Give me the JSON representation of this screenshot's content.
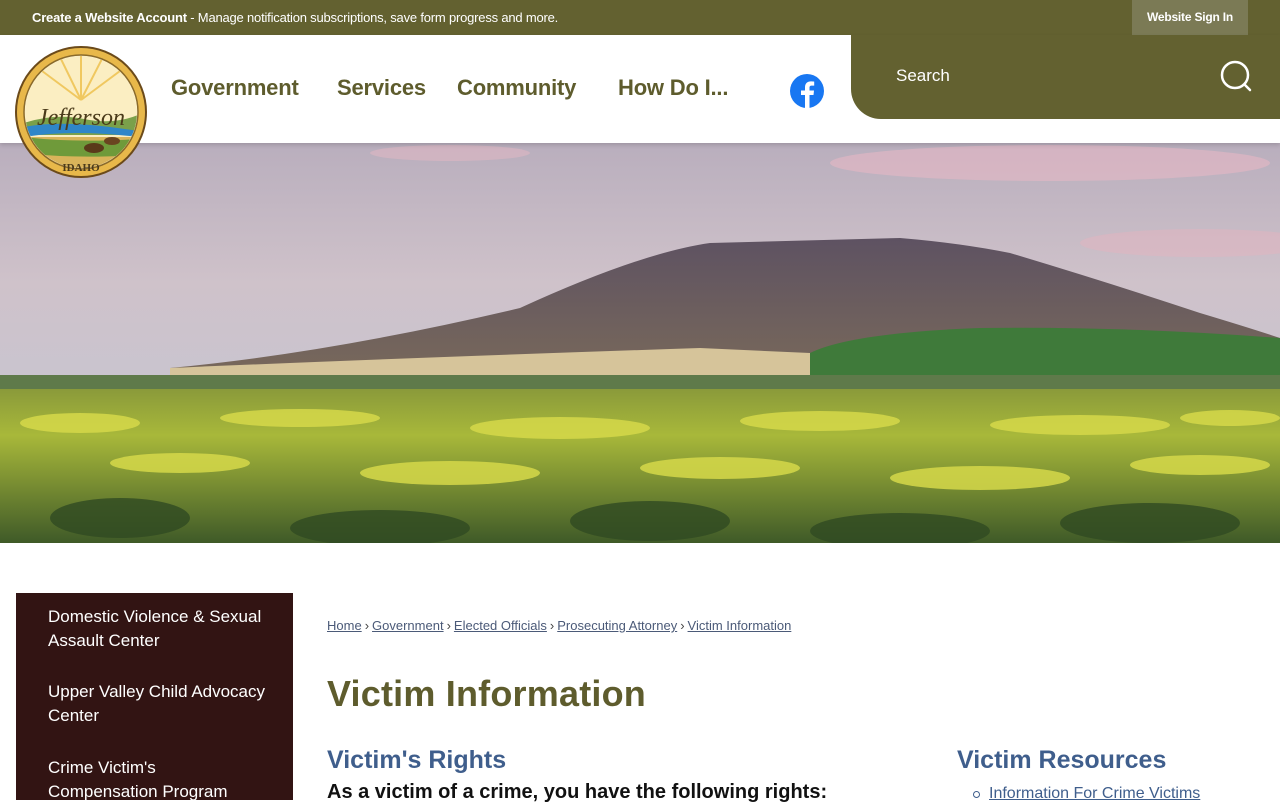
{
  "topbar": {
    "account_link": "Create a Website Account",
    "account_desc": " - Manage notification subscriptions, save form progress and more.",
    "signin_label": "Website Sign In"
  },
  "header": {
    "logo_icon": "jefferson-county-seal-icon",
    "nav": [
      {
        "label": "Government"
      },
      {
        "label": "Services"
      },
      {
        "label": "Community"
      },
      {
        "label": "How Do I..."
      }
    ],
    "social_icon": "facebook-icon",
    "search": {
      "placeholder": "Search",
      "icon": "search-icon"
    }
  },
  "colors": {
    "brand_olive": "#636130",
    "sidebar_bg": "#321413",
    "heading_blue": "#3f5e8c",
    "title_olive": "#5e5c2d",
    "facebook_blue": "#1877f2"
  },
  "sidebar": {
    "items": [
      {
        "label": "Domestic Violence & Sexual Assault Center"
      },
      {
        "label": "Upper Valley Child Advocacy Center"
      },
      {
        "label": "Crime Victim's Compensation Program"
      }
    ]
  },
  "breadcrumb": [
    {
      "label": "Home"
    },
    {
      "label": "Government"
    },
    {
      "label": "Elected Officials"
    },
    {
      "label": "Prosecuting Attorney"
    },
    {
      "label": "Victim Information"
    }
  ],
  "main": {
    "title": "Victim Information",
    "rights_heading": "Victim's Rights",
    "rights_intro": "As a victim of a crime, you have the following rights:",
    "resources_heading": "Victim Resources",
    "resources": [
      {
        "label": "Information For Crime Victims"
      }
    ]
  }
}
